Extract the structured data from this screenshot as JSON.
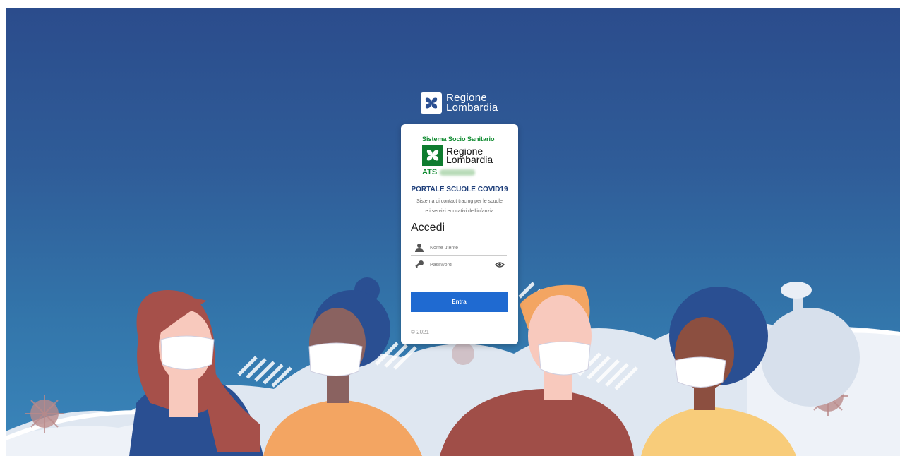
{
  "header": {
    "logo_line1": "Regione",
    "logo_line2": "Lombardia"
  },
  "card": {
    "system_label": "Sistema Socio Sanitario",
    "brand_line1": "Regione",
    "brand_line2": "Lombardia",
    "ats_label": "ATS",
    "portal_title": "PORTALE SCUOLE COVID19",
    "portal_subtitle_1": "Sistema di contact tracing per le scuole",
    "portal_subtitle_2": "e i servizi educativi dell'infanzia"
  },
  "login": {
    "heading": "Accedi",
    "username_placeholder": "Nome utente",
    "password_placeholder": "Password",
    "submit_label": "Entra",
    "copyright": "© 2021"
  },
  "icons": {
    "user": "user-icon",
    "key": "key-icon",
    "eye": "eye-icon",
    "logo": "regione-lombardia-logo-icon"
  },
  "colors": {
    "background_top": "#2b4c8c",
    "background_bottom": "#3a86bb",
    "primary_button": "#1f6ad1",
    "brand_green": "#0e7c2f",
    "title_blue": "#1f3f7a"
  }
}
